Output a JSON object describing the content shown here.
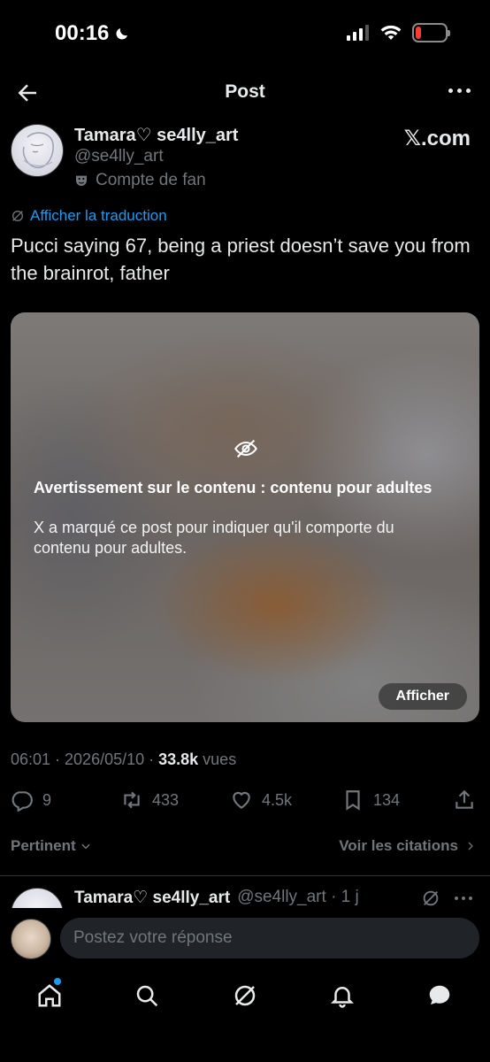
{
  "status_bar": {
    "time": "00:16"
  },
  "header": {
    "title": "Post"
  },
  "post": {
    "author_name": "Tamara♡ se4lly_art",
    "handle": "@se4lly_art",
    "fan_label": "Compte de fan",
    "source_badge": "𝕏.com",
    "translate_link": "Afficher la traduction",
    "text": "Pucci saying 67, being a priest doesn’t save you from the brainrot, father",
    "media_warning": {
      "title": "Avertissement sur le contenu : contenu pour adultes",
      "body": "X a marqué ce post pour indiquer qu'il comporte du contenu pour adultes.",
      "show_button": "Afficher"
    },
    "meta": {
      "time_date": "06:01 · 2026/05/10 · ",
      "views_count": "33.8k",
      "views_label": " vues"
    },
    "actions": {
      "replies": "9",
      "reposts": "433",
      "likes": "4.5k",
      "bookmarks": "134"
    }
  },
  "sort": {
    "left_label": "Pertinent",
    "right_label": "Voir les citations"
  },
  "reply_preview": {
    "name": "Tamara♡ se4lly_art",
    "handle_time": "@se4lly_art · 1 j"
  },
  "composer": {
    "placeholder": "Postez votre réponse"
  },
  "colors": {
    "accent": "#1d9bf0",
    "background": "#000000",
    "muted": "#71767b"
  }
}
